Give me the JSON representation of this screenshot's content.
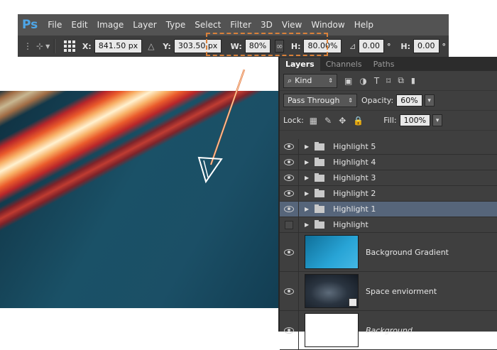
{
  "app": {
    "logo": "Ps"
  },
  "menu": [
    "File",
    "Edit",
    "Image",
    "Layer",
    "Type",
    "Select",
    "Filter",
    "3D",
    "View",
    "Window",
    "Help"
  ],
  "options": {
    "x_label": "X:",
    "x_value": "841.50 px",
    "y_label": "Y:",
    "y_value": "303.50 px",
    "w_label": "W:",
    "w_value": "80%",
    "h_label": "H:",
    "h_value": "80.00%",
    "angle_value": "0.00",
    "degree": "°",
    "hskew_label": "H:",
    "hskew_value": "0.00",
    "highlight_color": "#d9813a"
  },
  "panel": {
    "tabs": [
      {
        "label": "Layers",
        "active": true
      },
      {
        "label": "Channels",
        "active": false
      },
      {
        "label": "Paths",
        "active": false
      }
    ],
    "filter_kind": "Kind",
    "blend_mode": "Pass Through",
    "opacity_label": "Opacity:",
    "opacity_value": "60%",
    "lock_label": "Lock:",
    "fill_label": "Fill:",
    "fill_value": "100%",
    "groups": [
      {
        "name": "Highlight 5",
        "visible": true,
        "selected": false
      },
      {
        "name": "Highlight 4",
        "visible": true,
        "selected": false
      },
      {
        "name": "Highlight 3",
        "visible": true,
        "selected": false
      },
      {
        "name": "Highlight 2",
        "visible": true,
        "selected": false
      },
      {
        "name": "Highlight 1",
        "visible": true,
        "selected": true
      },
      {
        "name": "Highlight",
        "visible": false,
        "selected": false
      }
    ],
    "layers": [
      {
        "name": "Background Gradient",
        "thumb": "gradient",
        "italic": false
      },
      {
        "name": "Space enviorment",
        "thumb": "space",
        "italic": false
      },
      {
        "name": "Background",
        "thumb": "white",
        "italic": true
      }
    ]
  },
  "colors": {
    "selected_row": "#56657a",
    "panel_bg": "#3f3f3f",
    "accent_blue": "#4da6e8"
  }
}
